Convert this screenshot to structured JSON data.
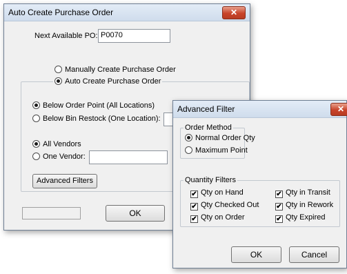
{
  "main_window": {
    "title": "Auto Create Purchase Order",
    "close_glyph": "✕",
    "next_po_label": "Next Available PO:",
    "next_po_value": "P0070",
    "manual_option": "Manually Create Purchase Order",
    "auto_option": "Auto Create Purchase Order",
    "below_order_point": "Below Order Point (All Locations)",
    "below_bin_restock": "Below Bin Restock (One Location):",
    "all_vendors": "All Vendors",
    "one_vendor": "One Vendor:",
    "advanced_filters_button": "Advanced Filters",
    "ok_button": "OK"
  },
  "advanced_filter": {
    "title": "Advanced Filter",
    "close_glyph": "✕",
    "order_method_legend": "Order Method",
    "normal_order_qty": "Normal Order Qty",
    "maximum_point": "Maximum Point",
    "quantity_filters_legend": "Quantity Filters",
    "qty_on_hand": "Qty on Hand",
    "qty_checked_out": "Qty Checked Out",
    "qty_on_order": "Qty on Order",
    "qty_in_transit": "Qty in Transit",
    "qty_in_rework": "Qty in Rework",
    "qty_expired": "Qty Expired",
    "check_glyph": "✔",
    "ok_button": "OK",
    "cancel_button": "Cancel"
  }
}
